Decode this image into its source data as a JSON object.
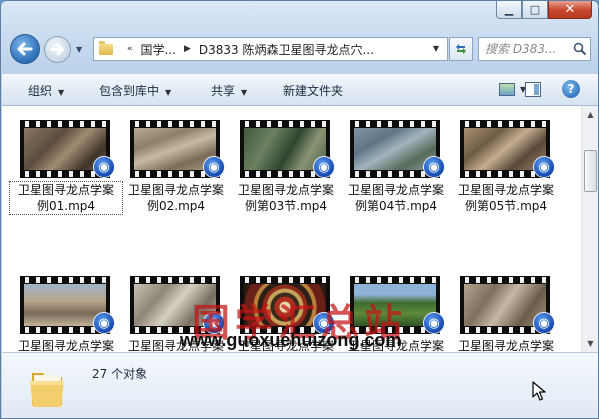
{
  "window": {
    "caption": {
      "minimize": "▁",
      "maximize": "□",
      "close": "✕"
    }
  },
  "address_bar": {
    "segments": [
      "国学...",
      "D3833 陈炳森卫星图寻龙点穴..."
    ],
    "search_placeholder": "搜索 D383..."
  },
  "toolbar": {
    "organize": "组织",
    "include_in_library": "包含到库中",
    "share": "共享",
    "new_folder": "新建文件夹"
  },
  "files": [
    {
      "line1": "卫星图寻龙点学案",
      "line2": "例01.mp4"
    },
    {
      "line1": "卫星图寻龙点学案",
      "line2": "例02.mp4"
    },
    {
      "line1": "卫星图寻龙点学案",
      "line2": "例第03节.mp4"
    },
    {
      "line1": "卫星图寻龙点学案",
      "line2": "例第04节.mp4"
    },
    {
      "line1": "卫星图寻龙点学案",
      "line2": "例第05节.mp4"
    },
    {
      "line1": "卫星图寻龙点学案",
      "line2": ""
    },
    {
      "line1": "卫星图寻龙点学案",
      "line2": ""
    },
    {
      "line1": "卫星图寻龙点学案",
      "line2": ""
    },
    {
      "line1": "卫星图寻龙点学案",
      "line2": ""
    },
    {
      "line1": "卫星图寻龙点学案",
      "line2": ""
    }
  ],
  "watermark": {
    "title": "国学汇总站",
    "url": "www.guoxuehuizong.com"
  },
  "details": {
    "item_count": "27 个对象"
  },
  "colors": {
    "accent": "#1a4fb6",
    "watermark_red": "#c41414"
  }
}
